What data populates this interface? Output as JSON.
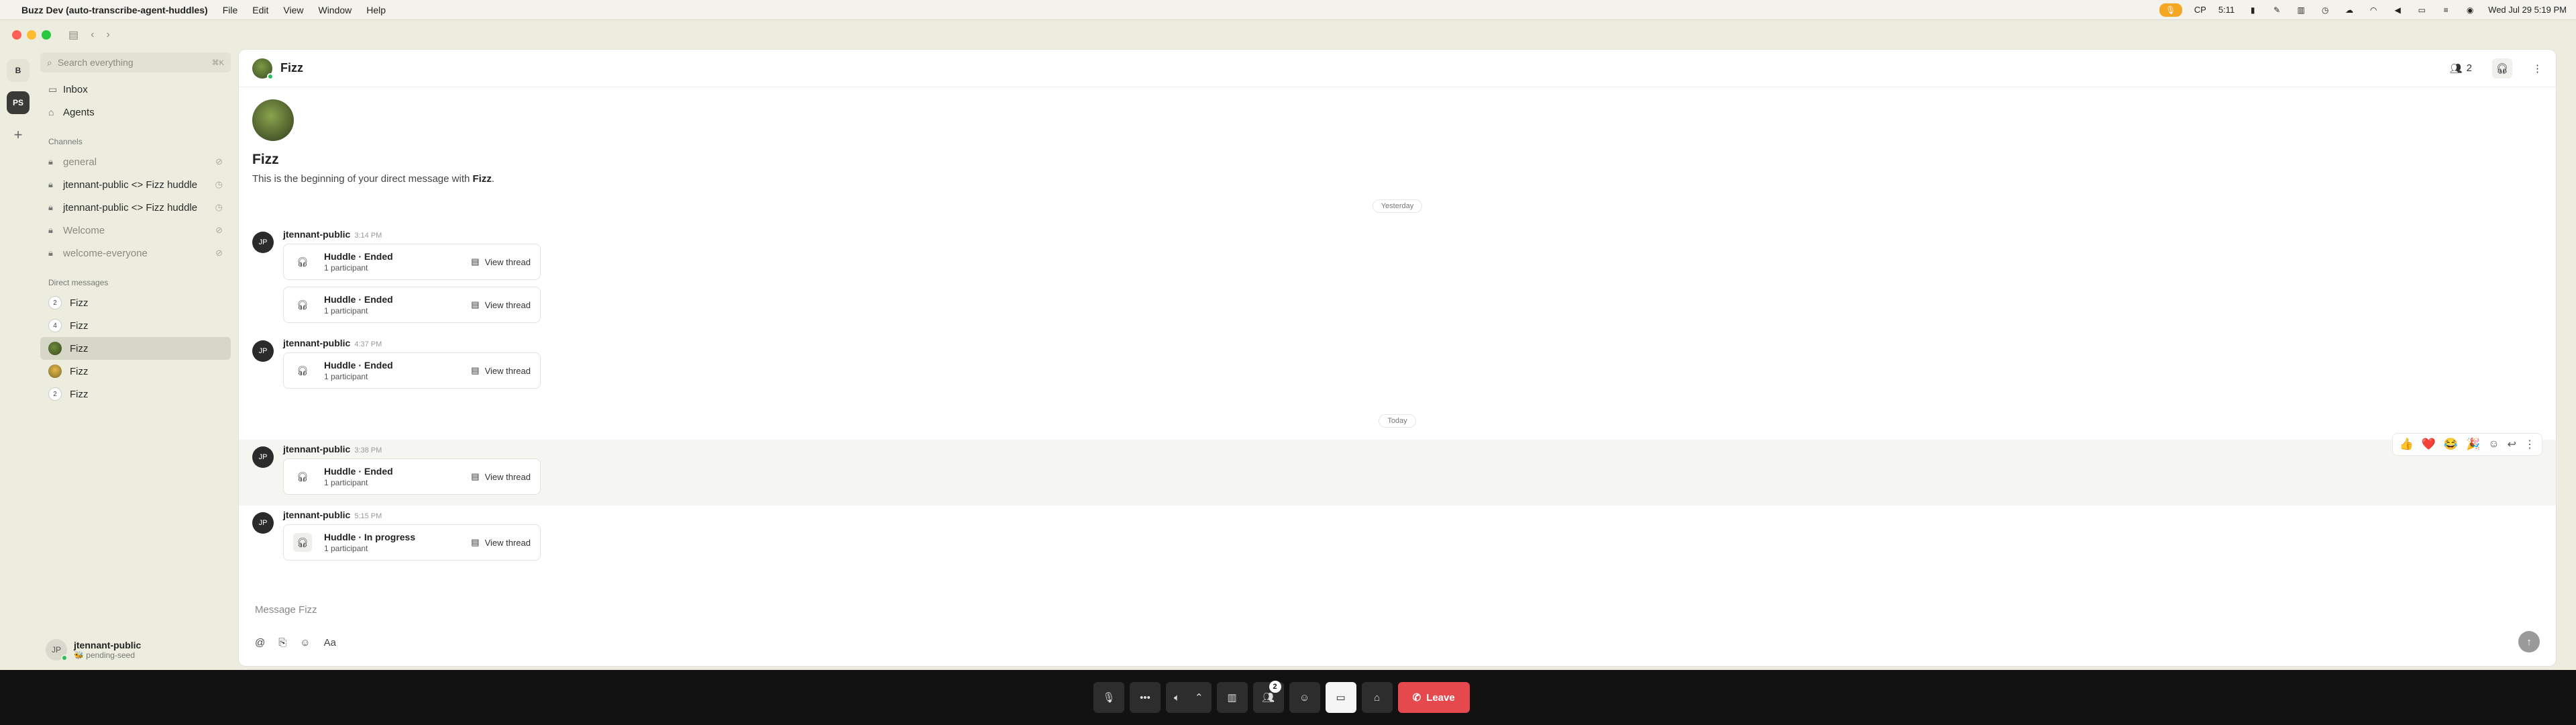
{
  "menubar": {
    "app_name": "Buzz Dev (auto-transcribe-agent-huddles)",
    "menus": [
      "File",
      "Edit",
      "View",
      "Window",
      "Help"
    ],
    "status_items": [
      "CP",
      "5:11"
    ],
    "datetime": "Wed Jul 29  5:19 PM"
  },
  "rail": {
    "workspaces": [
      "B",
      "PS"
    ]
  },
  "sidebar": {
    "search_placeholder": "Search everything",
    "search_shortcut": "⌘K",
    "nav": [
      {
        "label": "Inbox",
        "icon": "inbox-icon"
      },
      {
        "label": "Agents",
        "icon": "robot-icon"
      }
    ],
    "channels_title": "Channels",
    "channels": [
      {
        "label": "general",
        "muted": true
      },
      {
        "label": "jtennant-public <> Fizz huddle",
        "muted": false
      },
      {
        "label": "jtennant-public <> Fizz huddle",
        "muted": false
      },
      {
        "label": "Welcome",
        "muted": true
      },
      {
        "label": "welcome-everyone",
        "muted": true
      }
    ],
    "dms_title": "Direct messages",
    "dms": [
      {
        "label": "Fizz",
        "badge": "2",
        "active": false
      },
      {
        "label": "Fizz",
        "badge": "4",
        "active": false
      },
      {
        "label": "Fizz",
        "badge": "",
        "active": true
      },
      {
        "label": "Fizz",
        "badge": "",
        "active": false
      },
      {
        "label": "Fizz",
        "badge": "2",
        "active": false
      }
    ],
    "user": {
      "initials": "JP",
      "name": "jtennant-public",
      "status": "🐝 pending-seed"
    }
  },
  "header": {
    "title": "Fizz",
    "participants_count": "2"
  },
  "intro": {
    "title": "Fizz",
    "text_prefix": "This is the beginning of your direct message with ",
    "text_name": "Fizz",
    "text_suffix": "."
  },
  "dividers": {
    "yesterday": "Yesterday",
    "today": "Today"
  },
  "messages": [
    {
      "author": "jtennant-public",
      "initials": "JP",
      "time": "3:14 PM",
      "cards": [
        {
          "title": "Huddle · Ended",
          "subtitle": "1 participant",
          "action": "View thread"
        },
        {
          "title": "Huddle · Ended",
          "subtitle": "1 participant",
          "action": "View thread"
        }
      ]
    },
    {
      "author": "jtennant-public",
      "initials": "JP",
      "time": "4:37 PM",
      "cards": [
        {
          "title": "Huddle · Ended",
          "subtitle": "1 participant",
          "action": "View thread"
        }
      ]
    },
    {
      "author": "jtennant-public",
      "initials": "JP",
      "time": "3:38 PM",
      "cards": [
        {
          "title": "Huddle · Ended",
          "subtitle": "1 participant",
          "action": "View thread"
        }
      ]
    },
    {
      "author": "jtennant-public",
      "initials": "JP",
      "time": "5:15 PM",
      "cards": [
        {
          "title": "Huddle · In progress",
          "subtitle": "1 participant",
          "action": "View thread"
        }
      ]
    }
  ],
  "reactions": [
    "👍",
    "❤️",
    "😂",
    "🎉"
  ],
  "composer": {
    "placeholder": "Message Fizz",
    "format_label": "Aa"
  },
  "dock": {
    "people_badge": "2",
    "leave_label": "Leave"
  }
}
